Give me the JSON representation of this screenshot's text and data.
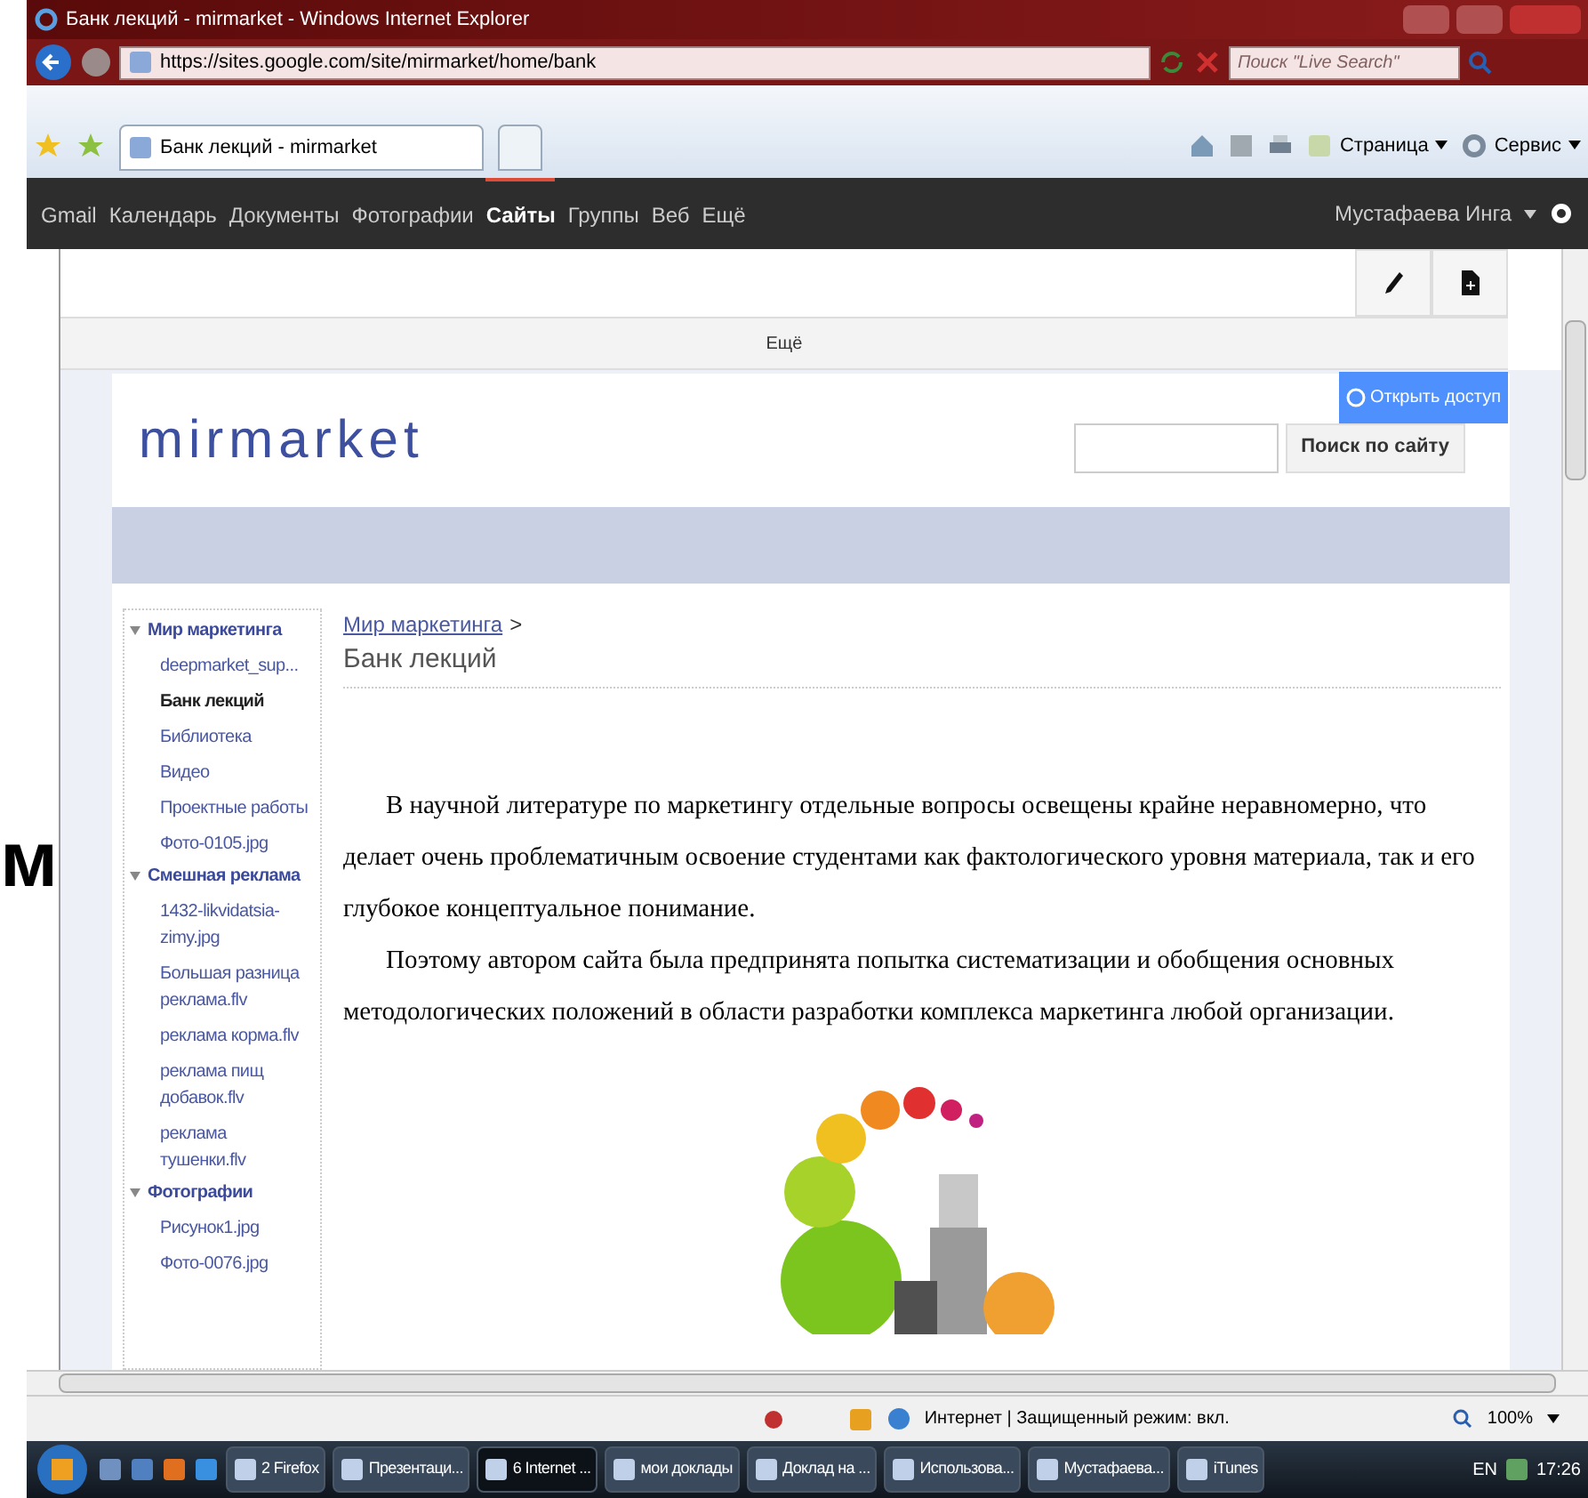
{
  "window": {
    "title": "Банк лекций - mirmarket - Windows Internet Explorer"
  },
  "address_bar": {
    "url": "https://sites.google.com/site/mirmarket/home/bank"
  },
  "search_box": {
    "placeholder": "Поиск \"Live Search\""
  },
  "tabs": [
    {
      "label": "Банк лекций - mirmarket",
      "selected": true
    }
  ],
  "command_bar": [
    {
      "label": "Страница",
      "kind": "page"
    },
    {
      "label": "Сервис",
      "kind": "tools"
    }
  ],
  "google_bar": {
    "links": [
      {
        "label": "Gmail",
        "selected": false
      },
      {
        "label": "Календарь",
        "selected": false
      },
      {
        "label": "Документы",
        "selected": false
      },
      {
        "label": "Фотографии",
        "selected": false
      },
      {
        "label": "Сайты",
        "selected": true
      },
      {
        "label": "Группы",
        "selected": false
      },
      {
        "label": "Веб",
        "selected": false
      },
      {
        "label": "Ещё",
        "selected": false
      }
    ],
    "user": "Мустафаева Инга"
  },
  "more_bar": "Ещё",
  "share_button": "Открыть доступ",
  "site": {
    "logo": "mirmarket",
    "search_button": "Поиск по сайту"
  },
  "sidebar": {
    "items": [
      {
        "label": "Мир маркетинга",
        "expanded": true,
        "children": [
          {
            "label": "deepmarket_sup...",
            "selected": false
          },
          {
            "label": "Банк лекций",
            "selected": true
          },
          {
            "label": "Библиотека",
            "selected": false
          },
          {
            "label": "Видео",
            "selected": false
          },
          {
            "label": "Проектные работы",
            "selected": false
          },
          {
            "label": "Фото-0105.jpg",
            "selected": false
          }
        ]
      },
      {
        "label": "Смешная реклама",
        "expanded": true,
        "children": [
          {
            "label": "1432-likvidatsia-zimy.jpg",
            "selected": false
          },
          {
            "label": "Большая разница реклама.flv",
            "selected": false
          },
          {
            "label": "реклама корма.flv",
            "selected": false
          },
          {
            "label": "реклама пищ добавок.flv",
            "selected": false
          },
          {
            "label": "реклама тушенки.flv",
            "selected": false
          }
        ]
      },
      {
        "label": "Фотографии",
        "expanded": true,
        "children": [
          {
            "label": "Рисунок1.jpg",
            "selected": false
          },
          {
            "label": "Фото-0076.jpg",
            "selected": false
          }
        ]
      }
    ]
  },
  "breadcrumb": {
    "link": "Мир маркетинга",
    "separator": ">"
  },
  "page_title": "Банк лекций",
  "paragraphs": [
    "В научной литературе по маркетингу отдельные вопросы освещены крайне неравномерно, что делает очень проблематичным освоение студентами как фактологического уровня материала, так и его глубокое концептуальное понимание.",
    "Поэтому  автором сайта была предпринята попытка систематизации и обобщения основных методологических положений в области разработки комплекса маркетинга любой организации."
  ],
  "status_bar": {
    "zone": "Интернет | Защищенный режим: вкл.",
    "zoom": "100%"
  },
  "taskbar": {
    "items": [
      {
        "label": "2 Firefox",
        "selected": false
      },
      {
        "label": "Презентаци...",
        "selected": false
      },
      {
        "label": "6 Internet ...",
        "selected": true
      },
      {
        "label": "мои доклады",
        "selected": false
      },
      {
        "label": "Доклад на ...",
        "selected": false
      },
      {
        "label": "Использова...",
        "selected": false
      },
      {
        "label": "Мустафаева...",
        "selected": false
      },
      {
        "label": "iTunes",
        "selected": false
      }
    ],
    "language": "EN",
    "time": "17:26"
  },
  "slide_fragment": "м"
}
